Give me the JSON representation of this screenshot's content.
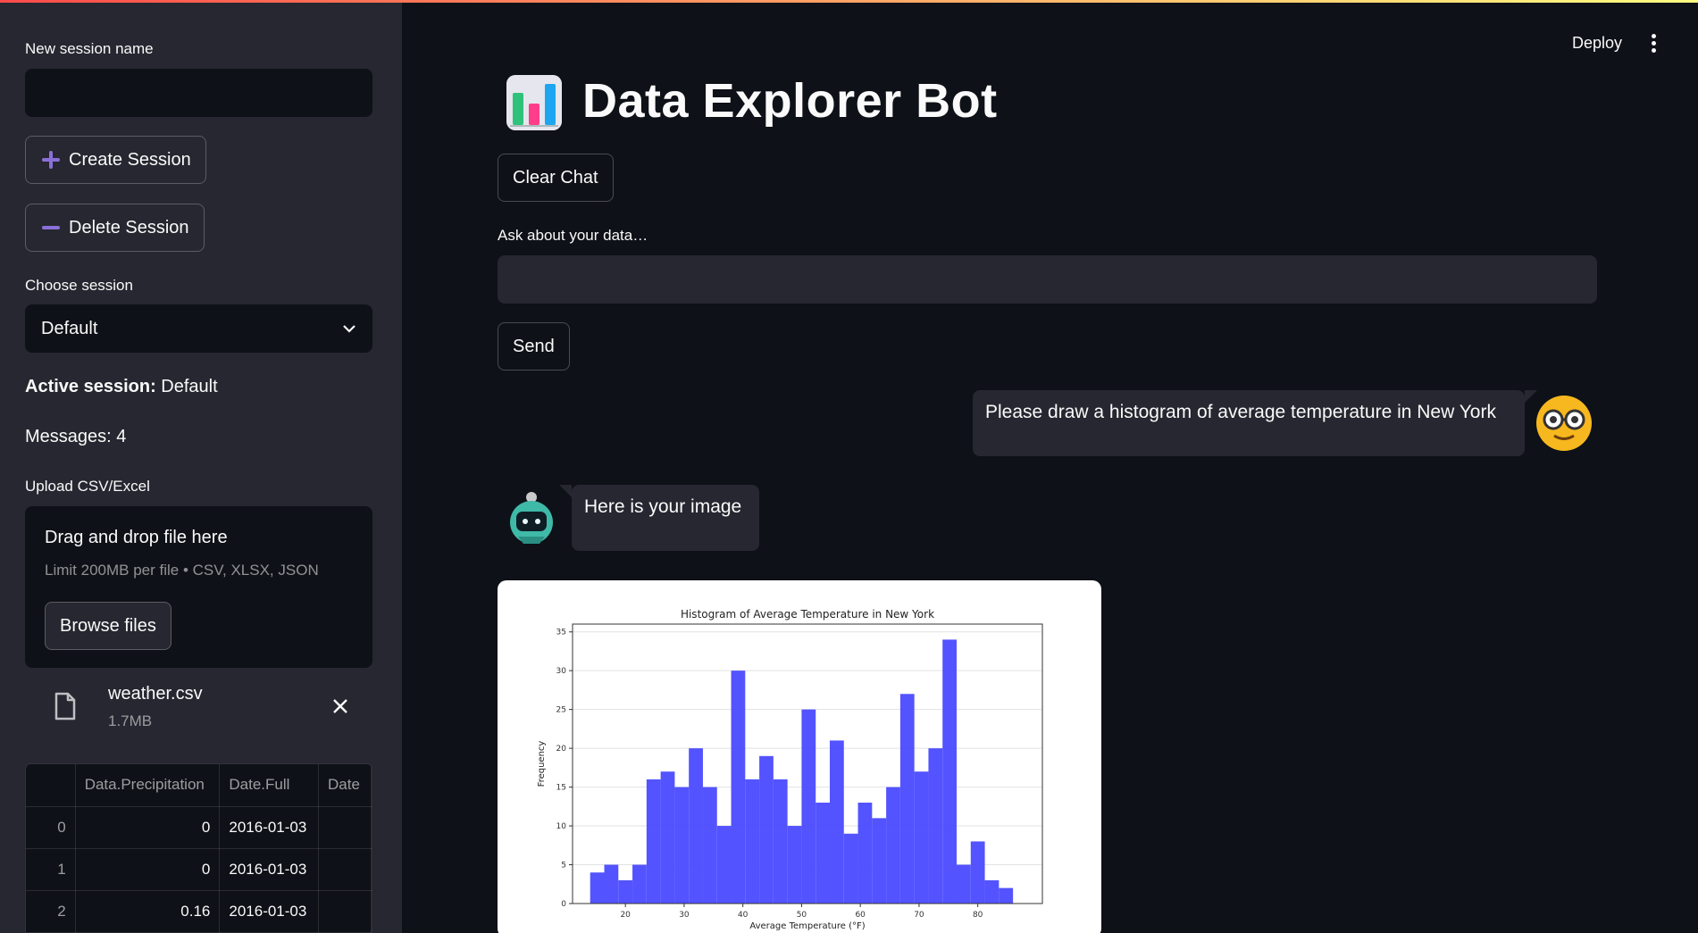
{
  "sidebar": {
    "new_session_label": "New session name",
    "new_session_value": "",
    "create_button": "Create Session",
    "delete_button": "Delete Session",
    "choose_session_label": "Choose session",
    "selected_session": "Default",
    "active_session_prefix": "Active session:",
    "active_session_value": "Default",
    "messages_text": "Messages: 4",
    "upload_label": "Upload CSV/Excel",
    "dropzone_title": "Drag and drop file here",
    "dropzone_limit": "Limit 200MB per file • CSV, XLSX, JSON",
    "browse_button": "Browse files",
    "file": {
      "name": "weather.csv",
      "size": "1.7MB"
    },
    "table": {
      "columns": [
        "",
        "Data.Precipitation",
        "Date.Full",
        "Date"
      ],
      "rows": [
        {
          "index": "0",
          "precip": "0",
          "date": "2016-01-03"
        },
        {
          "index": "1",
          "precip": "0",
          "date": "2016-01-03"
        },
        {
          "index": "2",
          "precip": "0.16",
          "date": "2016-01-03"
        }
      ]
    }
  },
  "header": {
    "deploy": "Deploy"
  },
  "main": {
    "title": "Data Explorer Bot",
    "clear_button": "Clear Chat",
    "ask_label": "Ask about your data…",
    "ask_value": "",
    "send_button": "Send",
    "messages": [
      {
        "role": "user",
        "text": "Please draw a histogram of average temperature in New York"
      },
      {
        "role": "assistant",
        "text": "Here is your image"
      }
    ]
  },
  "colors": {
    "accent": "#8b6fd8",
    "bar": "#4a4aff",
    "background": "#0e1117",
    "sidebar": "#262730"
  },
  "chart_data": {
    "type": "bar",
    "title": "Histogram of Average Temperature in New York",
    "xlabel": "Average Temperature (°F)",
    "ylabel": "Frequency",
    "xlim": [
      11,
      91
    ],
    "ylim": [
      0,
      36
    ],
    "xticks": [
      20,
      30,
      40,
      50,
      60,
      70,
      80
    ],
    "yticks": [
      0,
      5,
      10,
      15,
      20,
      25,
      30,
      35
    ],
    "grid": true,
    "bin_start": 14,
    "bin_width": 2.4,
    "values": [
      4,
      5,
      3,
      5,
      16,
      17,
      15,
      20,
      15,
      10,
      30,
      16,
      19,
      16,
      10,
      25,
      13,
      21,
      9,
      13,
      11,
      15,
      27,
      17,
      20,
      34,
      5,
      8,
      3,
      2
    ]
  }
}
